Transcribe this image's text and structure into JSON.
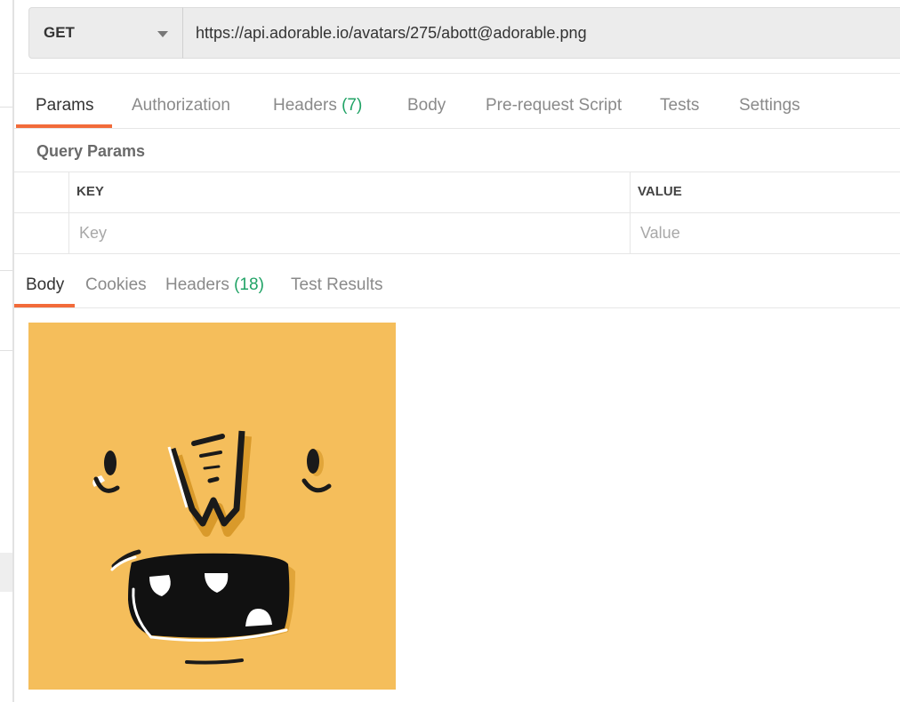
{
  "request": {
    "method": "GET",
    "url": "https://api.adorable.io/avatars/275/abott@adorable.png"
  },
  "request_tabs": [
    {
      "label": "Params",
      "count": "",
      "active": true
    },
    {
      "label": "Authorization",
      "count": "",
      "active": false
    },
    {
      "label": "Headers",
      "count": "(7)",
      "active": false
    },
    {
      "label": "Body",
      "count": "",
      "active": false
    },
    {
      "label": "Pre-request Script",
      "count": "",
      "active": false
    },
    {
      "label": "Tests",
      "count": "",
      "active": false
    },
    {
      "label": "Settings",
      "count": "",
      "active": false
    }
  ],
  "query_params": {
    "title": "Query Params",
    "columns": {
      "key": "KEY",
      "value": "VALUE"
    },
    "row": {
      "key_placeholder": "Key",
      "value_placeholder": "Value"
    }
  },
  "response_tabs": [
    {
      "label": "Body",
      "count": "",
      "active": true
    },
    {
      "label": "Cookies",
      "count": "",
      "active": false
    },
    {
      "label": "Headers",
      "count": "(18)",
      "active": false
    },
    {
      "label": "Test Results",
      "count": "",
      "active": false
    }
  ],
  "response_body": {
    "image_name": "avatar-image",
    "background_color": "#f5be5b"
  },
  "colors": {
    "accent_underline": "#f26b3a",
    "count_green": "#21a366"
  }
}
